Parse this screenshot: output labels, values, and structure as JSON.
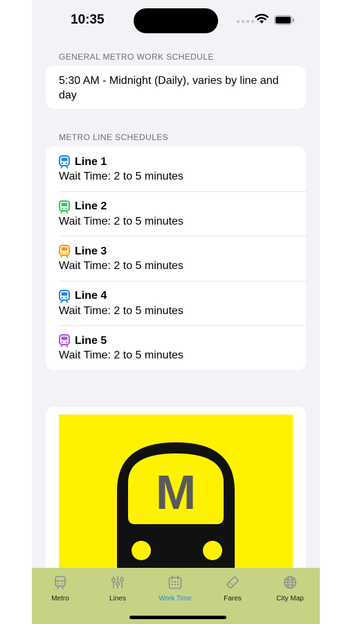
{
  "status_bar": {
    "time": "10:35"
  },
  "general": {
    "header": "GENERAL METRO WORK SCHEDULE",
    "text": "5:30 AM - Midnight (Daily), varies by line and day"
  },
  "lines_section": {
    "header": "METRO LINE SCHEDULES",
    "items": [
      {
        "name": "Line 1",
        "wait": "Wait Time: 2 to 5 minutes",
        "color": "#1e88e5",
        "icon": "tram-icon"
      },
      {
        "name": "Line 2",
        "wait": "Wait Time: 2 to 5 minutes",
        "color": "#34c759",
        "icon": "tram-icon"
      },
      {
        "name": "Line 3",
        "wait": "Wait Time: 2 to 5 minutes",
        "color": "#ff9500",
        "icon": "tram-icon"
      },
      {
        "name": "Line 4",
        "wait": "Wait Time: 2 to 5 minutes",
        "color": "#1e88e5",
        "icon": "tram-icon"
      },
      {
        "name": "Line 5",
        "wait": "Wait Time: 2 to 5 minutes",
        "color": "#af52de",
        "icon": "tram-icon"
      }
    ]
  },
  "logo": {
    "letter": "M",
    "background": "#fff200",
    "icon": "metro-train-logo"
  },
  "tabbar": {
    "tabs": [
      {
        "label": "Metro",
        "icon": "tram-icon",
        "active": false
      },
      {
        "label": "Lines",
        "icon": "sliders-icon",
        "active": false
      },
      {
        "label": "Work Time",
        "icon": "calendar-icon",
        "active": true
      },
      {
        "label": "Fares",
        "icon": "ticket-icon",
        "active": false
      },
      {
        "label": "City Map",
        "icon": "globe-icon",
        "active": false
      }
    ],
    "active_color": "#2f7fe6",
    "background": "#c5d384"
  }
}
